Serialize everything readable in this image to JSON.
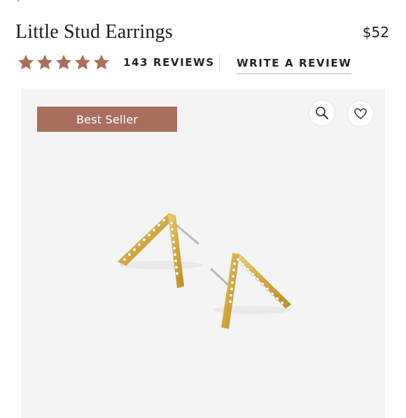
{
  "product": {
    "title": "Little Stud Earrings",
    "price": "$52",
    "rating": 5,
    "rating_max": 5,
    "reviews_label": "143 REVIEWS",
    "write_review_label": "WRITE A REVIEW",
    "badge_label": "Best Seller"
  },
  "colors": {
    "star": "#a86f5d",
    "badge_bg": "#a86f5d",
    "card_bg": "#f4f4f4",
    "gold": "#d9b24a"
  },
  "icons": {
    "zoom": "search-icon",
    "favorite": "heart-icon"
  }
}
